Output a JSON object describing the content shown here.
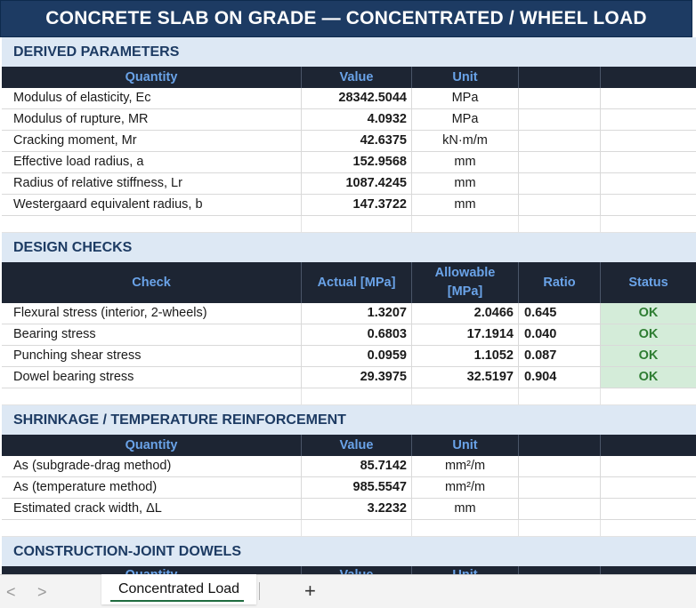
{
  "title": "CONCRETE SLAB ON GRADE — CONCENTRATED / WHEEL LOAD",
  "derived": {
    "heading": "DERIVED PARAMETERS",
    "headers": [
      "Quantity",
      "Value",
      "Unit"
    ],
    "rows": [
      {
        "label": "Modulus of elasticity, Ec",
        "value": "28342.5044",
        "unit": "MPa"
      },
      {
        "label": "Modulus of rupture, MR",
        "value": "4.0932",
        "unit": "MPa"
      },
      {
        "label": "Cracking moment, Mr",
        "value": "42.6375",
        "unit": "kN·m/m"
      },
      {
        "label": "Effective load radius, a",
        "value": "152.9568",
        "unit": "mm"
      },
      {
        "label": "Radius of relative stiffness, Lr",
        "value": "1087.4245",
        "unit": "mm"
      },
      {
        "label": "Westergaard equivalent radius, b",
        "value": "147.3722",
        "unit": "mm"
      }
    ]
  },
  "checks": {
    "heading": "DESIGN CHECKS",
    "headers": [
      "Check",
      "Actual [MPa]",
      "Allowable [MPa]",
      "Ratio",
      "Status"
    ],
    "rows": [
      {
        "label": "Flexural stress (interior, 2-wheels)",
        "actual": "1.3207",
        "allowable": "2.0466",
        "ratio": "0.645",
        "status": "OK"
      },
      {
        "label": "Bearing stress",
        "actual": "0.6803",
        "allowable": "17.1914",
        "ratio": "0.040",
        "status": "OK"
      },
      {
        "label": "Punching shear stress",
        "actual": "0.0959",
        "allowable": "1.1052",
        "ratio": "0.087",
        "status": "OK"
      },
      {
        "label": "Dowel bearing stress",
        "actual": "29.3975",
        "allowable": "32.5197",
        "ratio": "0.904",
        "status": "OK"
      }
    ]
  },
  "shrinkage": {
    "heading": "SHRINKAGE / TEMPERATURE REINFORCEMENT",
    "headers": [
      "Quantity",
      "Value",
      "Unit"
    ],
    "rows": [
      {
        "label": "As (subgrade-drag method)",
        "value": "85.7142",
        "unit": "mm²/m"
      },
      {
        "label": "As (temperature method)",
        "value": "985.5547",
        "unit": "mm²/m"
      },
      {
        "label": "Estimated crack width, ΔL",
        "value": "3.2232",
        "unit": "mm"
      }
    ]
  },
  "dowels": {
    "heading": "CONSTRUCTION-JOINT DOWELS",
    "headers": [
      "Quantity",
      "Value",
      "Unit"
    ]
  },
  "tabs": {
    "active": "Concentrated Load",
    "prev_icon": "<",
    "next_icon": ">",
    "add_icon": "+"
  },
  "colors": {
    "title_bg": "#1d3b63",
    "header_bg": "#1d2533",
    "header_text": "#6aa3e8",
    "section_bg": "#dde8f4",
    "ok_bg": "#d4ecd9",
    "ok_text": "#2e7d32"
  }
}
